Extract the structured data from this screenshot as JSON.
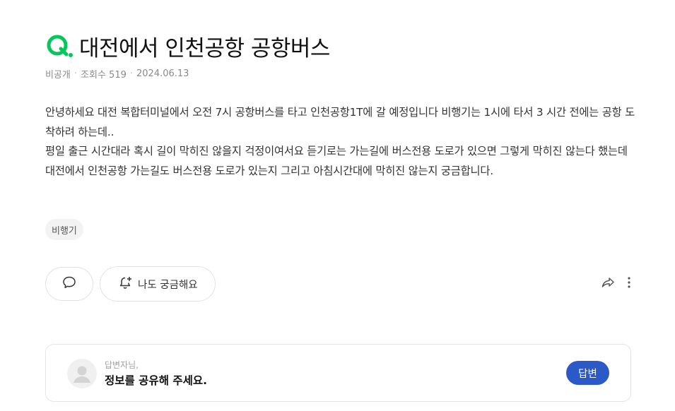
{
  "question": {
    "prefix_icon": "q-mark-icon",
    "title": "대전에서 인천공항 공항버스",
    "meta": {
      "visibility": "비공개",
      "views": "조회수 519",
      "date": "2024.06.13"
    },
    "body_lines": [
      "안녕하세요 대전 복합터미널에서 오전 7시 공항버스를 타고 인천공항1T에 갈 예정입니다 비행기는 1시에 타서 3 시간 전에는 공항 도착하려 하는데..",
      "평일 출근 시간대라 혹시 길이 막히진 않을지 걱정이여서요 듣기로는 가는길에 버스전용 도로가 있으면 그렇게 막히진 않는다 했는데 대전에서 인천공항 가는길도 버스전용 도로가 있는지 그리고 아침시간대에 막히진 않는지 궁금합니다."
    ],
    "tag": "비행기"
  },
  "actions": {
    "comment_icon": "speech-bubble-icon",
    "curious_icon": "bell-plus-icon",
    "curious_label": "나도 궁금해요",
    "share_icon": "share-arrow-icon",
    "more_icon": "more-vertical-icon"
  },
  "answer": {
    "avatar_icon": "user-avatar-icon",
    "name_label": "답변자님,",
    "prompt": "정보를 공유해 주세요.",
    "button_label": "답변"
  },
  "colors": {
    "brand_green": "#03c75a",
    "answer_button": "#2c59c8",
    "meta_text": "#8a8a8a"
  }
}
